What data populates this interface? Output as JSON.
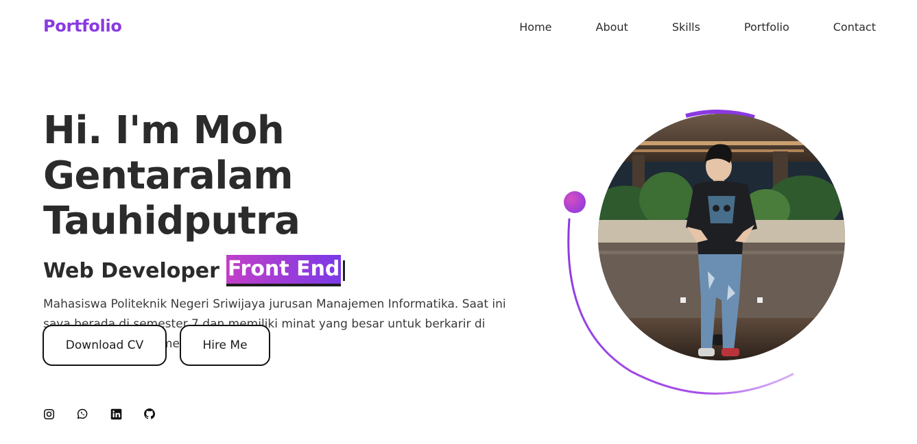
{
  "brand": {
    "logo": "Portfolio",
    "accent": "#8a3ae0",
    "gradient_start": "#c23fc8",
    "gradient_end": "#7a3ae6"
  },
  "nav": {
    "items": [
      "Home",
      "About",
      "Skills",
      "Portfolio",
      "Contact"
    ]
  },
  "hero": {
    "title_line1": "Hi. I'm Moh Gentaralam",
    "title_line2": "Tauhidputra",
    "role_prefix": "Web Developer",
    "role_highlight": "Front End",
    "description": "Mahasiswa Politeknik Negeri Sriwijaya jurusan Manajemen Informatika. Saat ini saya berada di semester 7 dan memiliki minat yang besar untuk berkarir di bidang web development."
  },
  "buttons": {
    "download_cv": "Download CV",
    "hire_me": "Hire Me"
  },
  "social": {
    "icons": [
      "instagram-icon",
      "whatsapp-icon",
      "linkedin-icon",
      "github-icon"
    ]
  }
}
